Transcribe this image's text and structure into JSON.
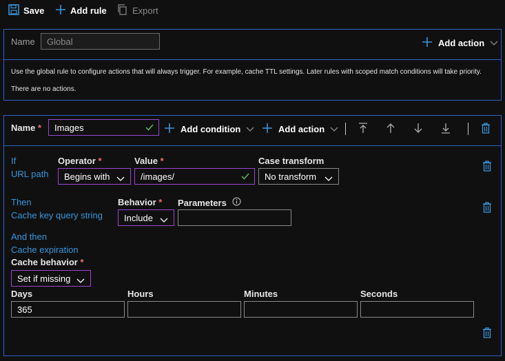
{
  "toolbar": {
    "save": "Save",
    "add_rule": "Add rule",
    "export": "Export"
  },
  "global_rule": {
    "name_label": "Name",
    "name_value": "Global",
    "add_action": "Add action",
    "description": "Use the global rule to configure actions that will always trigger. For example, cache TTL settings. Later rules with scoped match conditions will take priority.",
    "no_actions": "There are no actions."
  },
  "rule": {
    "name_label": "Name",
    "required": "*",
    "name_value": "Images",
    "add_condition": "Add condition",
    "add_action": "Add action",
    "condition": {
      "prefix": "If",
      "title": "URL path",
      "operator_label": "Operator",
      "operator_value": "Begins with",
      "value_label": "Value",
      "value_value": "/images/",
      "case_label": "Case transform",
      "case_value": "No transform"
    },
    "action1": {
      "prefix": "Then",
      "title": "Cache key query string",
      "behavior_label": "Behavior",
      "behavior_value": "Include",
      "params_label": "Parameters",
      "params_value": ""
    },
    "action2": {
      "prefix": "And then",
      "title": "Cache expiration",
      "cache_behavior_label": "Cache behavior",
      "cache_behavior_value": "Set if missing",
      "days_label": "Days",
      "days_value": "365",
      "hours_label": "Hours",
      "hours_value": "",
      "minutes_label": "Minutes",
      "minutes_value": "",
      "seconds_label": "Seconds",
      "seconds_value": ""
    }
  },
  "colors": {
    "accent_border": "#2d64c8",
    "link_blue": "#3a96dd",
    "required_red": "#f26e6e",
    "focus_purple": "#9a46d4",
    "valid_green": "#5fb85f"
  }
}
